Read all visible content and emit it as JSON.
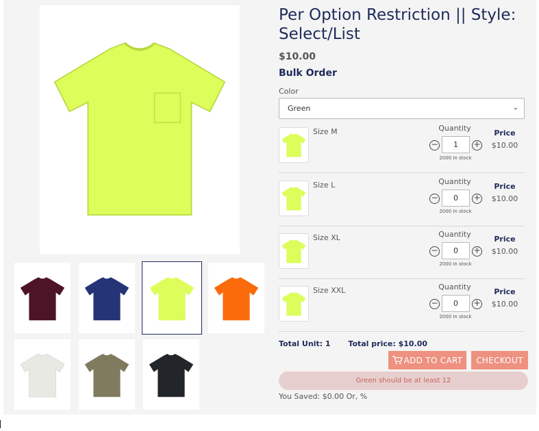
{
  "product": {
    "title": "Per Option Restriction || Style: Select/List",
    "price": "$10.00",
    "bulk_title": "Bulk Order",
    "color_label": "Color",
    "color_selected": "Green",
    "main_image_color": "#dcfd5a"
  },
  "gallery": [
    {
      "name": "maroon",
      "color": "#4d1427"
    },
    {
      "name": "navy",
      "color": "#253476"
    },
    {
      "name": "safety-green",
      "color": "#dcfd5a"
    },
    {
      "name": "orange",
      "color": "#fb6b0c"
    },
    {
      "name": "white",
      "color": "#e9e9e4"
    },
    {
      "name": "military-green",
      "color": "#807a5f"
    },
    {
      "name": "black",
      "color": "#22262a"
    }
  ],
  "variants": [
    {
      "size": "Size  M",
      "quantity_label": "Quantity",
      "quantity": "1",
      "stock": "2000 In stock",
      "price_label": "Price",
      "price": "$10.00"
    },
    {
      "size": "Size  L",
      "quantity_label": "Quantity",
      "quantity": "0",
      "stock": "2000 In stock",
      "price_label": "Price",
      "price": "$10.00"
    },
    {
      "size": "Size  XL",
      "quantity_label": "Quantity",
      "quantity": "0",
      "stock": "2000 In stock",
      "price_label": "Price",
      "price": "$10.00"
    },
    {
      "size": "Size  XXL",
      "quantity_label": "Quantity",
      "quantity": "0",
      "stock": "2000 In stock",
      "price_label": "Price",
      "price": "$10.00"
    }
  ],
  "summary": {
    "total_unit": "Total Unit: 1",
    "total_price": "Total price:  $10.00",
    "add_to_cart": "ADD TO CART",
    "checkout": "CHECKOUT",
    "alert": "Green should be at least 12",
    "saved": "You Saved: $0.00 Or, %"
  },
  "colors": {
    "accent": "#ee9180",
    "heading": "#1e2a5a",
    "alert_bg": "#e8cfcf",
    "alert_text": "#c0655a"
  },
  "icons": {
    "cart": "cart-icon",
    "minus": "minus-circle-icon",
    "plus": "plus-circle-icon",
    "chevron": "chevron-down-icon"
  }
}
